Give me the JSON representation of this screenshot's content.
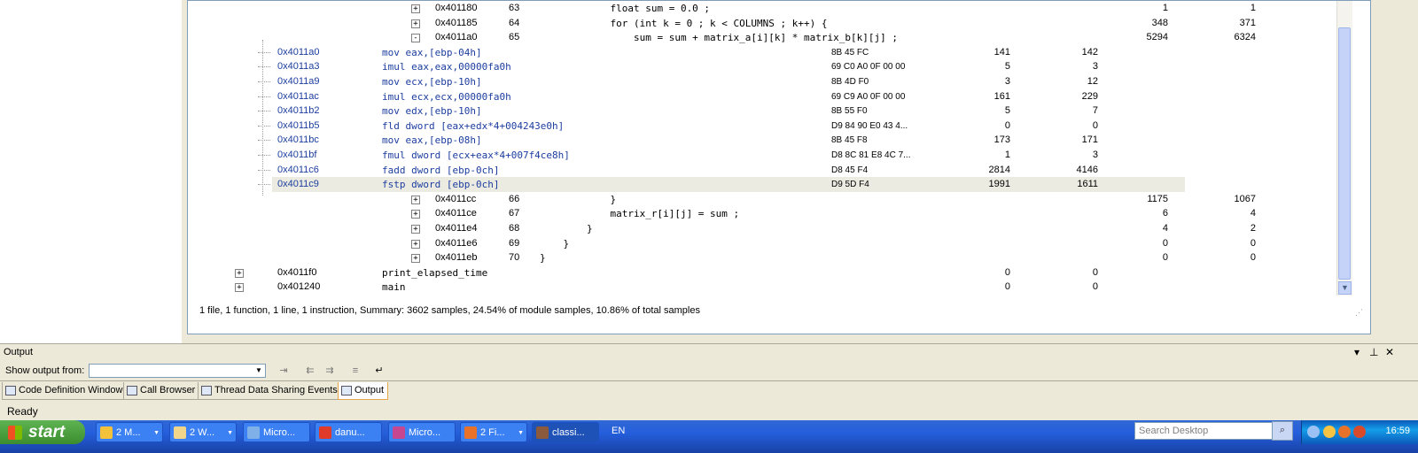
{
  "rows": [
    {
      "addr": "0x401180",
      "line": "63",
      "src": "            float sum = 0.0 ;",
      "bytes": "",
      "v1": "1",
      "v2": "1",
      "type": "line",
      "exp": "+"
    },
    {
      "addr": "0x401185",
      "line": "64",
      "src": "            for (int k = 0 ; k < COLUMNS ; k++) {",
      "bytes": "",
      "v1": "348",
      "v2": "371",
      "type": "line",
      "exp": "+"
    },
    {
      "addr": "0x4011a0",
      "line": "65",
      "src": "                sum = sum + matrix_a[i][k] * matrix_b[k][j] ;",
      "bytes": "",
      "v1": "5294",
      "v2": "6324",
      "type": "line",
      "exp": "−"
    },
    {
      "addr": "0x4011a0",
      "line": "",
      "src": "mov eax,[ebp-04h]",
      "bytes": "8B 45 FC",
      "v1": "141",
      "v2": "142",
      "type": "sub"
    },
    {
      "addr": "0x4011a3",
      "line": "",
      "src": "imul eax,eax,00000fa0h",
      "bytes": "69 C0 A0 0F 00 00",
      "v1": "5",
      "v2": "3",
      "type": "sub"
    },
    {
      "addr": "0x4011a9",
      "line": "",
      "src": "mov ecx,[ebp-10h]",
      "bytes": "8B 4D F0",
      "v1": "3",
      "v2": "12",
      "type": "sub"
    },
    {
      "addr": "0x4011ac",
      "line": "",
      "src": "imul ecx,ecx,00000fa0h",
      "bytes": "69 C9 A0 0F 00 00",
      "v1": "161",
      "v2": "229",
      "type": "sub"
    },
    {
      "addr": "0x4011b2",
      "line": "",
      "src": "mov edx,[ebp-10h]",
      "bytes": "8B 55 F0",
      "v1": "5",
      "v2": "7",
      "type": "sub"
    },
    {
      "addr": "0x4011b5",
      "line": "",
      "src": "fld dword [eax+edx*4+004243e0h]",
      "bytes": "D9 84 90 E0 43 4...",
      "v1": "0",
      "v2": "0",
      "type": "sub"
    },
    {
      "addr": "0x4011bc",
      "line": "",
      "src": "mov eax,[ebp-08h]",
      "bytes": "8B 45 F8",
      "v1": "173",
      "v2": "171",
      "type": "sub"
    },
    {
      "addr": "0x4011bf",
      "line": "",
      "src": "fmul dword [ecx+eax*4+007f4ce8h]",
      "bytes": "D8 8C 81 E8 4C 7...",
      "v1": "1",
      "v2": "3",
      "type": "sub"
    },
    {
      "addr": "0x4011c6",
      "line": "",
      "src": "fadd dword [ebp-0ch]",
      "bytes": "D8 45 F4",
      "v1": "2814",
      "v2": "4146",
      "type": "sub"
    },
    {
      "addr": "0x4011c9",
      "line": "",
      "src": "fstp dword [ebp-0ch]",
      "bytes": "D9 5D F4",
      "v1": "1991",
      "v2": "1611",
      "type": "sub",
      "selected": true
    },
    {
      "addr": "0x4011cc",
      "line": "66",
      "src": "            }",
      "bytes": "",
      "v1": "1175",
      "v2": "1067",
      "type": "line",
      "exp": "+"
    },
    {
      "addr": "0x4011ce",
      "line": "67",
      "src": "            matrix_r[i][j] = sum ;",
      "bytes": "",
      "v1": "6",
      "v2": "4",
      "type": "line",
      "exp": "+"
    },
    {
      "addr": "0x4011e4",
      "line": "68",
      "src": "        }",
      "bytes": "",
      "v1": "4",
      "v2": "2",
      "type": "line",
      "exp": "+"
    },
    {
      "addr": "0x4011e6",
      "line": "69",
      "src": "    }",
      "bytes": "",
      "v1": "0",
      "v2": "0",
      "type": "line",
      "exp": "+"
    },
    {
      "addr": "0x4011eb",
      "line": "70",
      "src": "}",
      "bytes": "",
      "v1": "0",
      "v2": "0",
      "type": "line",
      "exp": "+"
    },
    {
      "addr": "0x4011f0",
      "line": "",
      "src": "print_elapsed_time",
      "bytes": "",
      "v1": "0",
      "v2": "0",
      "type": "func",
      "exp": "+"
    },
    {
      "addr": "0x401240",
      "line": "",
      "src": "main",
      "bytes": "",
      "v1": "0",
      "v2": "0",
      "type": "func",
      "exp": "+"
    }
  ],
  "summary": "1 file, 1 function, 1 line, 1 instruction, Summary: 3602 samples, 24.54% of module samples, 10.86% of total samples",
  "output": {
    "title": "Output",
    "show_output_from_label": "Show output from:",
    "selected_source": ""
  },
  "tabs": [
    {
      "label": "Code Definition Window",
      "icon": "code-definition-icon"
    },
    {
      "label": "Call Browser",
      "icon": "call-browser-icon"
    },
    {
      "label": "Thread Data Sharing Events",
      "icon": "thread-data-icon"
    },
    {
      "label": "Output",
      "icon": "output-icon",
      "active": true
    }
  ],
  "status": "Ready",
  "taskbar": {
    "start_label": "start",
    "tasks": [
      {
        "label": "2 M...",
        "icon": "messenger-icon",
        "group": true
      },
      {
        "label": "2 W...",
        "icon": "folder-icon",
        "group": true
      },
      {
        "label": "Micro...",
        "icon": "visual-studio-icon"
      },
      {
        "label": "danu...",
        "icon": "app-icon"
      },
      {
        "label": "Micro...",
        "icon": "visual-studio-icon"
      },
      {
        "label": "2 Fi...",
        "icon": "firefox-icon",
        "group": true
      },
      {
        "label": "classi...",
        "icon": "app-icon",
        "active": true
      }
    ],
    "language": "EN",
    "search_placeholder": "Search Desktop",
    "clock": "16:59"
  }
}
